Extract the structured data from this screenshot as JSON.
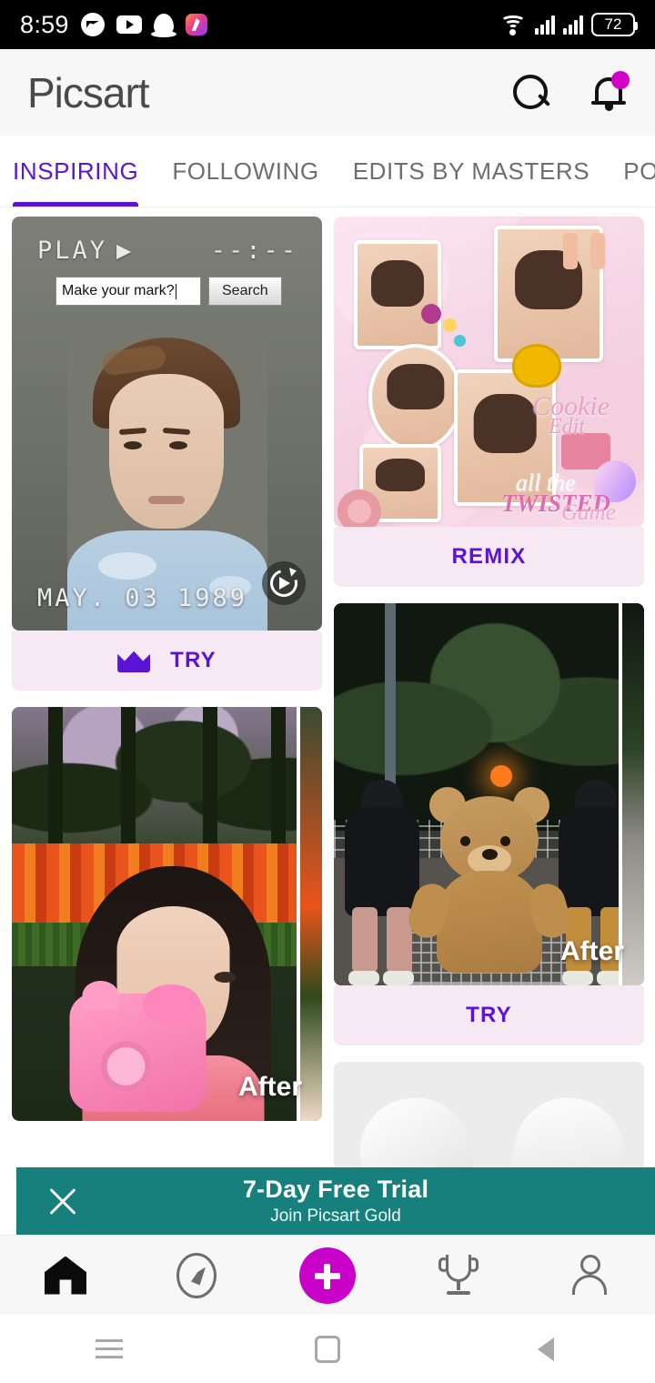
{
  "status_bar": {
    "time": "8:59",
    "battery": "72",
    "icons": [
      "messenger-icon",
      "youtube-icon",
      "snapchat-icon",
      "picsart-icon"
    ],
    "right_icons": [
      "wifi-icon",
      "signal-icon-1",
      "signal-icon-2",
      "battery-icon"
    ]
  },
  "header": {
    "logo": "Picsart",
    "search_icon": "search-icon",
    "notifications_icon": "bell-icon",
    "has_notification_dot": true
  },
  "tabs": [
    {
      "label": "INSPIRING",
      "active": true
    },
    {
      "label": "FOLLOWING",
      "active": false
    },
    {
      "label": "EDITS BY MASTERS",
      "active": false
    },
    {
      "label": "POPULAR S",
      "active": false
    }
  ],
  "feed": {
    "left_column": [
      {
        "type": "retro-video-card",
        "overlay": {
          "play_label": "PLAY",
          "play_icon": "play-triangle-icon",
          "timecode": "--:--",
          "search_value": "Make your mark?",
          "search_button": "Search",
          "date_stamp": "MAY. 03  1989",
          "replay_icon": "replay-icon"
        },
        "cta": {
          "label": "TRY",
          "icon": "crown-icon"
        }
      },
      {
        "type": "before-after-card",
        "after_label": "After",
        "subject": "girl-with-pink-camera-in-tulip-field"
      }
    ],
    "right_column": [
      {
        "type": "collage-card",
        "subject": "pink-aesthetic-kpop-collage",
        "collage_text": [
          "all the",
          "TWISTED",
          "Game",
          "Cookie",
          "Edit"
        ],
        "cta": {
          "label": "REMIX"
        }
      },
      {
        "type": "before-after-card",
        "after_label": "After",
        "subject": "night-street-teddy-bear-shopping-cart",
        "cta": {
          "label": "TRY"
        }
      },
      {
        "type": "partial-card",
        "subject": "white-bunny-ears"
      }
    ]
  },
  "promo_banner": {
    "title": "7-Day Free Trial",
    "subtitle": "Join Picsart Gold",
    "close_icon": "close-icon",
    "color": "#17807c"
  },
  "bottom_nav": [
    {
      "name": "home",
      "icon": "home-icon",
      "active": true
    },
    {
      "name": "discover",
      "icon": "compass-icon",
      "active": false
    },
    {
      "name": "create",
      "icon": "plus-icon",
      "active": false
    },
    {
      "name": "challenges",
      "icon": "trophy-icon",
      "active": false
    },
    {
      "name": "profile",
      "icon": "person-icon",
      "active": false
    }
  ],
  "android_nav": [
    {
      "name": "recents",
      "icon": "menu-icon"
    },
    {
      "name": "home",
      "icon": "square-icon"
    },
    {
      "name": "back",
      "icon": "back-triangle-icon"
    }
  ],
  "colors": {
    "accent_purple": "#5b14d6",
    "cta_bg": "#f6e9f4",
    "create_magenta": "#c800c8",
    "banner_teal": "#17807c",
    "notification_dot": "#d400c8"
  }
}
